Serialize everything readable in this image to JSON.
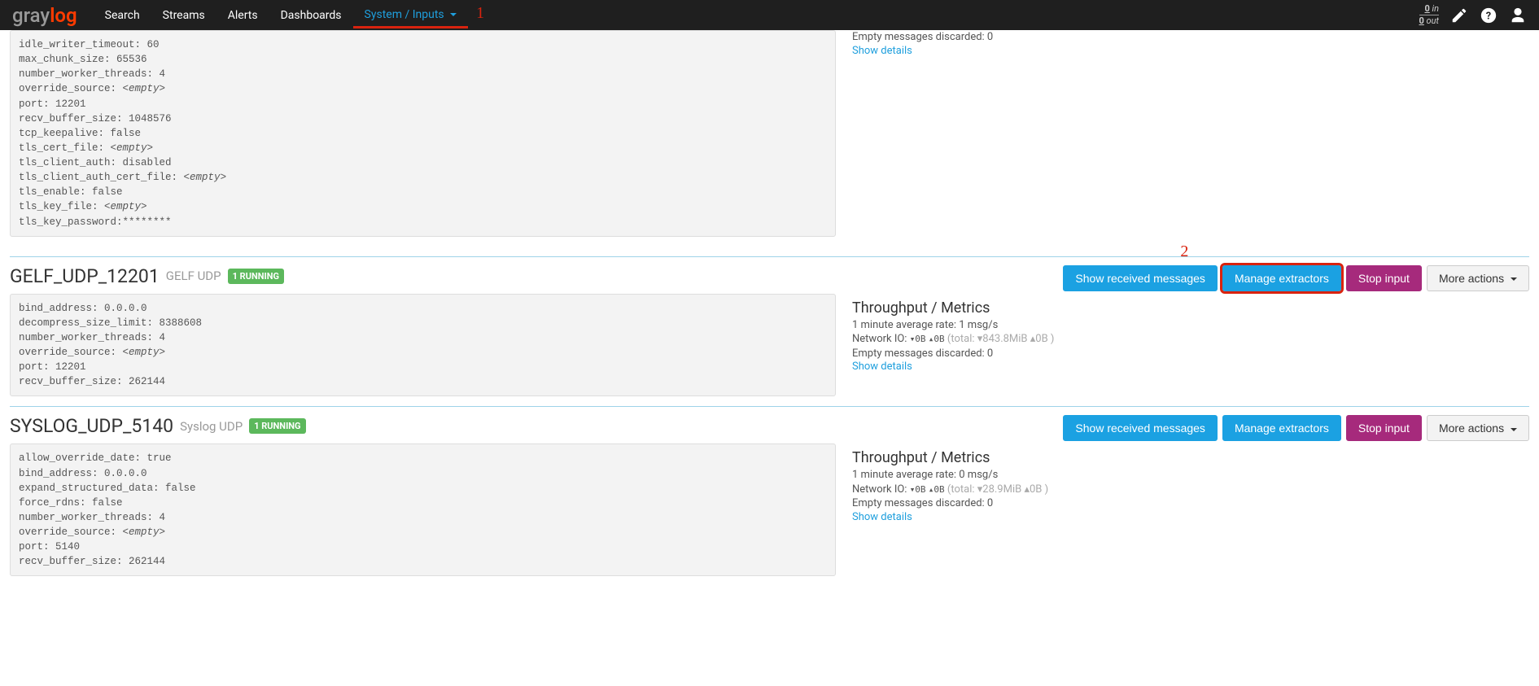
{
  "navbar": {
    "brand_gray": "gray",
    "brand_orange": "log",
    "items": [
      "Search",
      "Streams",
      "Alerts",
      "Dashboards",
      "System / Inputs"
    ],
    "io_in_num": "0",
    "io_in_label": " in",
    "io_out_num": "0",
    "io_out_label": " out"
  },
  "annotations": {
    "nav": "1",
    "extractors": "2"
  },
  "top_config": "idle_writer_timeout: 60\nmax_chunk_size: 65536\nnumber_worker_threads: 4\noverride_source: <empty>\nport: 12201\nrecv_buffer_size: 1048576\ntcp_keepalive: false\ntls_cert_file: <empty>\ntls_client_auth: disabled\ntls_client_auth_cert_file: <empty>\ntls_enable: false\ntls_key_file: <empty>\ntls_key_password:********",
  "top_metrics": {
    "discarded": "Empty messages discarded: 0",
    "details": "Show details"
  },
  "buttons": {
    "show_msgs": "Show received messages",
    "manage_ext": "Manage extractors",
    "stop": "Stop input",
    "more": "More actions"
  },
  "inputs": [
    {
      "title": "GELF_UDP_12201",
      "type": "GELF UDP",
      "badge": "1 RUNNING",
      "config": "bind_address: 0.0.0.0\ndecompress_size_limit: 8388608\nnumber_worker_threads: 4\noverride_source: <empty>\nport: 12201\nrecv_buffer_size: 262144",
      "highlight_ext": true,
      "metrics": {
        "title": "Throughput / Metrics",
        "avg": "1 minute average rate: 1 msg/s",
        "netio_prefix": "Network IO: ",
        "netio_down": "▾0B",
        "netio_up": "▴0B",
        "netio_total": " (total: ▾843.8MiB ▴0B )",
        "discarded": "Empty messages discarded: 0",
        "details": "Show details"
      }
    },
    {
      "title": "SYSLOG_UDP_5140",
      "type": "Syslog UDP",
      "badge": "1 RUNNING",
      "config": "allow_override_date: true\nbind_address: 0.0.0.0\nexpand_structured_data: false\nforce_rdns: false\nnumber_worker_threads: 4\noverride_source: <empty>\nport: 5140\nrecv_buffer_size: 262144",
      "highlight_ext": false,
      "metrics": {
        "title": "Throughput / Metrics",
        "avg": "1 minute average rate: 0 msg/s",
        "netio_prefix": "Network IO: ",
        "netio_down": "▾0B",
        "netio_up": "▴0B",
        "netio_total": " (total: ▾28.9MiB ▴0B )",
        "discarded": "Empty messages discarded: 0",
        "details": "Show details"
      }
    }
  ]
}
